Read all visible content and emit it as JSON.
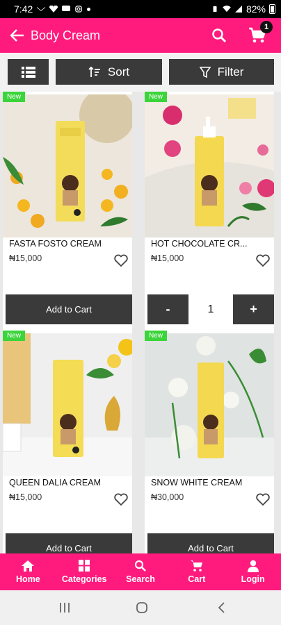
{
  "status": {
    "time": "7:42",
    "battery": "82%"
  },
  "header": {
    "title": "Body Cream",
    "cart_count": "1"
  },
  "toolbar": {
    "sort_label": "Sort",
    "filter_label": "Filter"
  },
  "products": [
    {
      "badge": "New",
      "name": "FASTA FOSTO CREAM",
      "price": "₦15,000",
      "action": "Add to Cart"
    },
    {
      "badge": "New",
      "name": "HOT CHOCOLATE CR...",
      "price": "₦15,000",
      "qty": "1",
      "minus": "-",
      "plus": "+"
    },
    {
      "badge": "New",
      "name": "QUEEN DALIA CREAM",
      "price": "₦15,000",
      "action": "Add to Cart"
    },
    {
      "badge": "New",
      "name": "SNOW WHITE CREAM",
      "price": "₦30,000",
      "action": "Add to Cart"
    }
  ],
  "bottom_nav": [
    {
      "label": "Home",
      "icon": "home-icon"
    },
    {
      "label": "Categories",
      "icon": "categories-icon"
    },
    {
      "label": "Search",
      "icon": "search-icon"
    },
    {
      "label": "Cart",
      "icon": "cart-icon"
    },
    {
      "label": "Login",
      "icon": "person-icon"
    }
  ],
  "colors": {
    "brand": "#ff1a7d",
    "button": "#3a3a3a",
    "badge": "#3bd43b"
  }
}
